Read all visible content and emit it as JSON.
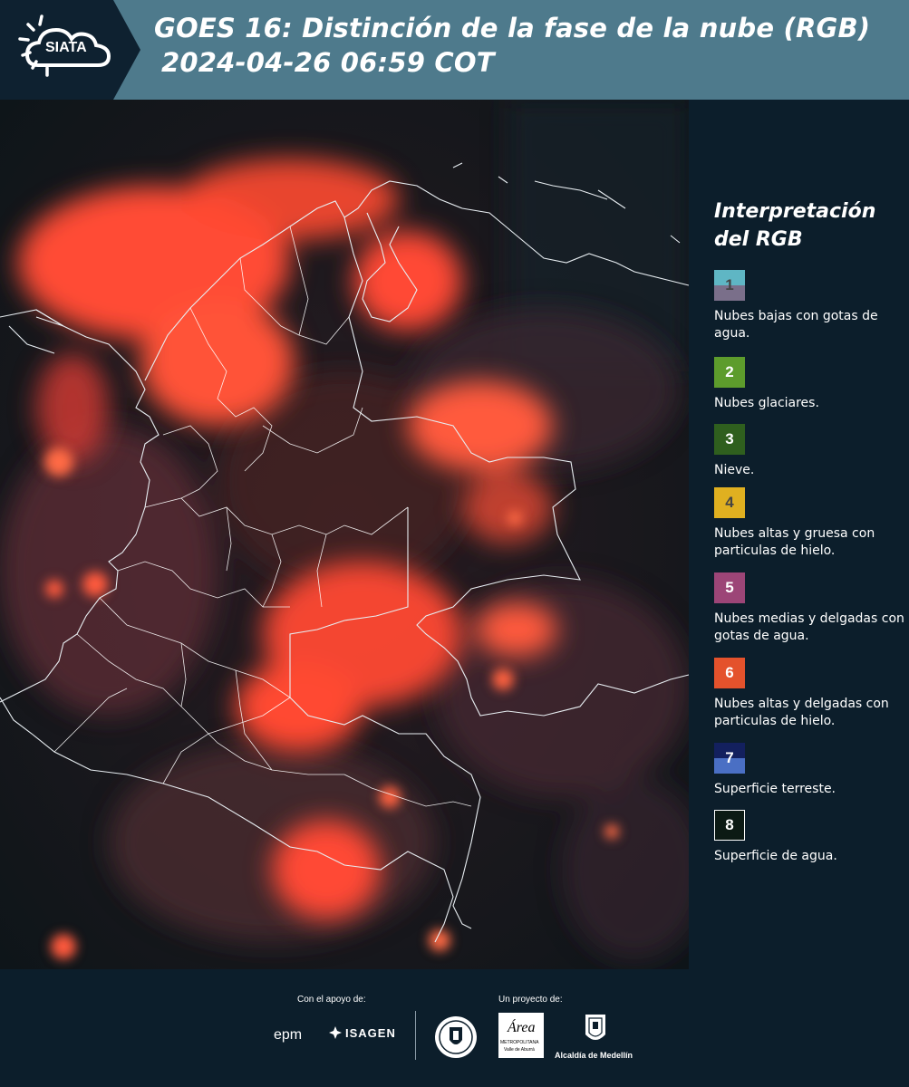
{
  "header": {
    "logo_text": "SIATA",
    "title_line1": "GOES 16: Distinción de la fase de la nube (RGB)",
    "title_line2": "2024-04-26 06:59 COT"
  },
  "legend": {
    "title": "Interpretación del RGB",
    "items": [
      {
        "number": "1",
        "label": "Nubes bajas con gotas de agua.",
        "color_top": "#5fb6c4",
        "color_bottom": "#7a6f8a",
        "text_color": "#444444"
      },
      {
        "number": "2",
        "label": "Nubes glaciares.",
        "color_top": "#5d9c2c",
        "color_bottom": "#5d9c2c",
        "text_color": "#ffffff"
      },
      {
        "number": "3",
        "label": "Nieve.",
        "color_top": "#2f5f1e",
        "color_bottom": "#2f5f1e",
        "text_color": "#ffffff"
      },
      {
        "number": "4",
        "label": "Nubes altas y gruesa con particulas de hielo.",
        "color_top": "#e0b020",
        "color_bottom": "#e0b020",
        "text_color": "#444444"
      },
      {
        "number": "5",
        "label": "Nubes medias y delgadas con gotas de agua.",
        "color_top": "#9c4577",
        "color_bottom": "#9c4577",
        "text_color": "#ffffff"
      },
      {
        "number": "6",
        "label": "Nubes altas y delgadas con particulas de hielo.",
        "color_top": "#e4522c",
        "color_bottom": "#e4522c",
        "text_color": "#ffffff"
      },
      {
        "number": "7",
        "label": "Superficie terreste.",
        "color_top": "#13205e",
        "color_bottom": "#4a6fc4",
        "text_color": "#ffffff"
      },
      {
        "number": "8",
        "label": "Superficie de agua.",
        "color_top": "#0c1a14",
        "color_bottom": "#0c1a14",
        "text_color": "#ffffff"
      }
    ]
  },
  "footer": {
    "support_label": "Con el apoyo de:",
    "project_label": "Un proyecto de:",
    "epm": "epm",
    "isagen": "ISAGEN",
    "area_text": "Área",
    "area_sub": "METROPOLITANA",
    "area_sub2": "Valle de Aburrá",
    "alcaldia": "Alcaldía de Medellín"
  },
  "colors": {
    "header_bg": "#4e7a8c",
    "logo_tab_bg": "#0e2130",
    "panel_bg": "#0c1e2b",
    "cloud_red": "#ff4a32"
  }
}
